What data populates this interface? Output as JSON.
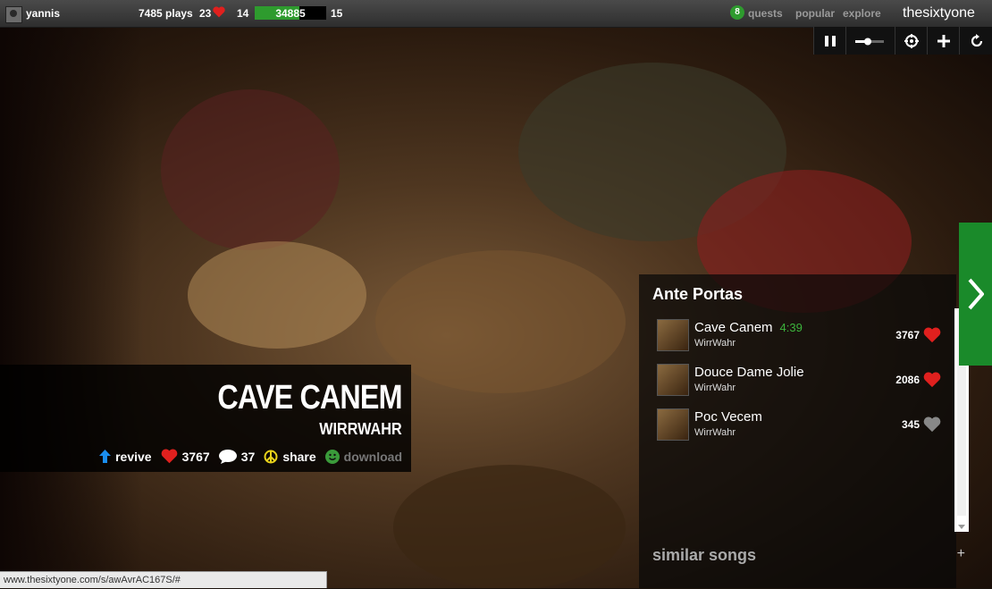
{
  "user": {
    "name": "yannis",
    "plays": "7485 plays",
    "loves": "23",
    "level_current": "14",
    "xp": "34885",
    "xp_fraction": 0.62,
    "level_next": "15"
  },
  "nav": {
    "quests_count": "8",
    "quests": "quests",
    "popular": "popular",
    "explore": "explore",
    "brand": "thesixtyone"
  },
  "song": {
    "title": "CAVE CANEM",
    "artist": "WIRRWAHR",
    "revive": "revive",
    "hearts": "3767",
    "comments": "37",
    "share": "share",
    "download": "download"
  },
  "playlist": {
    "title": "Ante Portas",
    "tracks": [
      {
        "name": "Cave Canem",
        "duration": "4:39",
        "artist": "WirrWahr",
        "count": "3767",
        "loved": true
      },
      {
        "name": "Douce Dame Jolie",
        "duration": "",
        "artist": "WirrWahr",
        "count": "2086",
        "loved": true
      },
      {
        "name": "Poc Vecem",
        "duration": "",
        "artist": "WirrWahr",
        "count": "345",
        "loved": false
      }
    ],
    "similar": "similar songs",
    "similar_plus": "+"
  },
  "status": {
    "url": "www.thesixtyone.com/s/awAvrAC167S/#"
  },
  "colors": {
    "accent_green": "#2e9b2e",
    "heart_red": "#e0201e"
  }
}
